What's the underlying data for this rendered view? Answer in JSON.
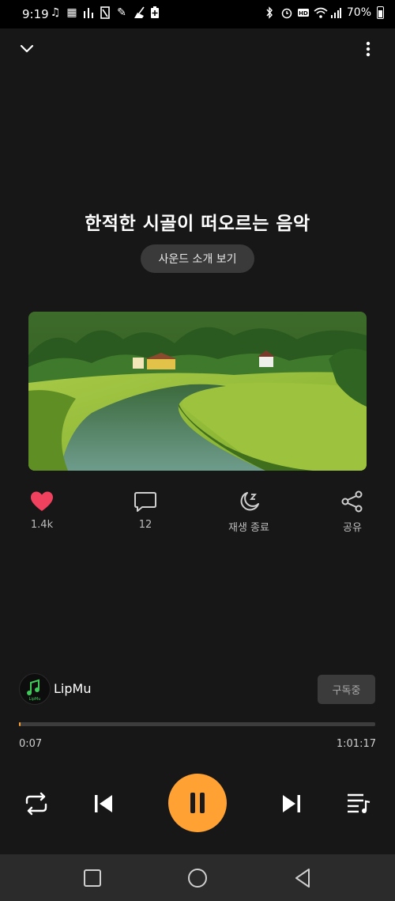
{
  "status_bar": {
    "time": "9:19",
    "battery": "70%",
    "left_icons": [
      "music-note-icon",
      "gallery-icon",
      "equalizer-icon",
      "sim-icon",
      "pen-icon",
      "broom-icon",
      "battery-plus-icon"
    ],
    "right_icons": [
      "bluetooth-icon",
      "alarm-icon",
      "hd-icon",
      "wifi-icon",
      "signal-icon"
    ]
  },
  "player": {
    "title": "한적한 시골이 떠오르는 음악",
    "sound_intro_button": "사운드 소개 보기",
    "actions": {
      "like_count": "1.4k",
      "comment_count": "12",
      "sleep_timer_label": "재생 종료",
      "share_label": "공유"
    },
    "channel": {
      "name": "LipMu",
      "avatar_text": "LipMu",
      "subscribe_label": "구독중"
    },
    "progress": {
      "current": "0:07",
      "total": "1:01:17",
      "fraction": 0.002
    }
  },
  "colors": {
    "accent": "#ffa233",
    "background": "#171717",
    "like": "#f0415e",
    "navbar": "#2b2b2b"
  }
}
